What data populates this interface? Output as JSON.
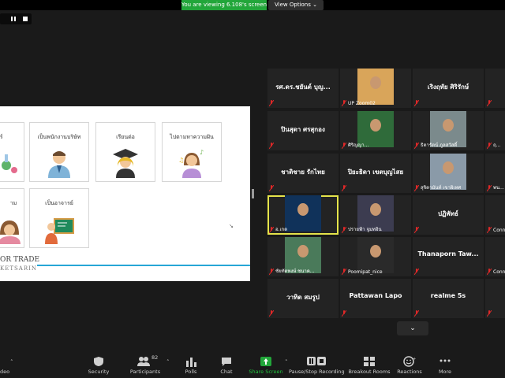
{
  "app": {
    "viewing_banner": "You are viewing 6.108's screen",
    "view_options": "View Options ⌄"
  },
  "share": {
    "cards": [
      {
        "label": "ศาสตร์"
      },
      {
        "label": "เป็นพนักงานบริษัท"
      },
      {
        "label": "เรียนต่อ"
      },
      {
        "label": "ไปตามหาความฝัน"
      },
      {
        "label": "าม"
      },
      {
        "label": "เป็นอาจารย์"
      }
    ],
    "footer_line1": "OR TRADE",
    "footer_line2": "KETSARIN",
    "corner_mark": "↘"
  },
  "gallery": {
    "tiles": [
      {
        "name": "รศ.ดร.ชยันต์ บุญ...",
        "sub": ""
      },
      {
        "name": "",
        "sub": "UP Zoom02"
      },
      {
        "name": "เริงฤทัย ศิริรักษ์",
        "sub": ""
      },
      {
        "name": "นา...",
        "sub": ""
      },
      {
        "name": "ปินสุดา ศรสุกอง",
        "sub": ""
      },
      {
        "name": "",
        "sub": "ศิริญญา..."
      },
      {
        "name": "",
        "sub": "ธิดารัตน์ ภูลสวัสดิ์"
      },
      {
        "name": "",
        "sub": "ฤ..."
      },
      {
        "name": "ชาติชาย รักไทย",
        "sub": ""
      },
      {
        "name": "ปิยะธิดา เขตบุญไสย",
        "sub": ""
      },
      {
        "name": "",
        "sub": "สุจิตามันท์ เขาผิเทศ"
      },
      {
        "name": "",
        "sub": "พน..."
      },
      {
        "name": "",
        "sub": "อ.เกด"
      },
      {
        "name": "",
        "sub": "ปรายฟ้า จูมทอิน"
      },
      {
        "name": "ปฏิพัทธ์",
        "sub": ""
      },
      {
        "name": "",
        "sub": "Conne..."
      },
      {
        "name": "",
        "sub": "ชัยทัตพงษ์ ชนาค..."
      },
      {
        "name": "",
        "sub": "Poomipat_nice"
      },
      {
        "name": "Thanaporn Taw...",
        "sub": ""
      },
      {
        "name": "W...",
        "sub": "Conne..."
      },
      {
        "name": "วาทิต สมรูป",
        "sub": ""
      },
      {
        "name": "Pattawan Lapo",
        "sub": ""
      },
      {
        "name": "realme 5s",
        "sub": ""
      },
      {
        "name": "ก...",
        "sub": ""
      }
    ],
    "scroll_down": "⌄"
  },
  "toolbar": {
    "video": "deo",
    "security": "Security",
    "participants": "Participants",
    "participants_count": "82",
    "polls": "Polls",
    "chat": "Chat",
    "share_screen": "Share Screen",
    "pause_recording": "Pause/Stop Recording",
    "breakout": "Breakout Rooms",
    "reactions": "Reactions",
    "more": "More"
  },
  "colors": {
    "share_green": "#22a63a",
    "active_speaker": "#e4e34a",
    "mute_red": "#e02828"
  }
}
